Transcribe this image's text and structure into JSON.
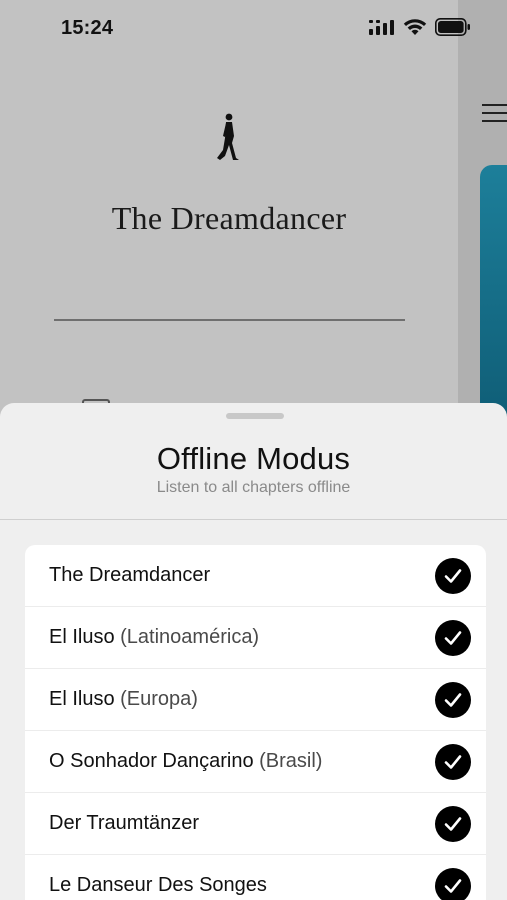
{
  "status_bar": {
    "time": "15:24",
    "icons": [
      "cellular-signal-icon",
      "wifi-icon",
      "battery-icon"
    ]
  },
  "background": {
    "logo": "walking-man-icon",
    "title": "The Dreamdancer",
    "menu_icon": "hamburger-menu-icon"
  },
  "sheet": {
    "title": "Offline Modus",
    "subtitle": "Listen to all chapters offline",
    "items": [
      {
        "name": "The Dreamdancer",
        "region": "",
        "checked": true
      },
      {
        "name": "El Iluso",
        "region": " (Latinoamérica)",
        "checked": true
      },
      {
        "name": "El Iluso",
        "region": " (Europa)",
        "checked": true
      },
      {
        "name": "O Sonhador Dançarino",
        "region": " (Brasil)",
        "checked": true
      },
      {
        "name": "Der Traumtänzer",
        "region": "",
        "checked": true
      },
      {
        "name": "Le Danseur Des Songes",
        "region": "",
        "checked": true
      }
    ]
  },
  "colors": {
    "check_fill": "#000000",
    "sheet_bg": "#efefef",
    "accent_teal": "#1d7f9a"
  }
}
